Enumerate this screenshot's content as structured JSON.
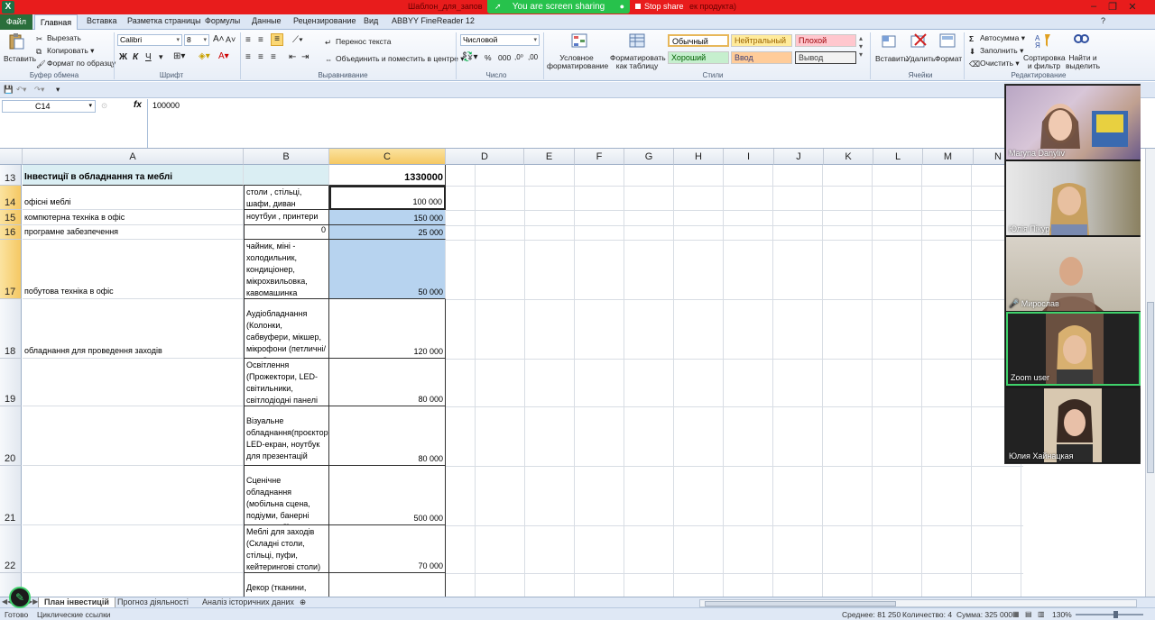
{
  "window": {
    "title_left": "Шаблон_для_запов",
    "title_right": "ек продукта)",
    "sharing_label": "You are screen sharing",
    "stop_share_label": "Stop share",
    "app_icon": "X"
  },
  "tabs": {
    "file": "Файл",
    "items": [
      "Главная",
      "Вставка",
      "Разметка страницы",
      "Формулы",
      "Данные",
      "Рецензирование",
      "Вид",
      "ABBYY FineReader 12"
    ]
  },
  "ribbon": {
    "clipboard": {
      "paste": "Вставить",
      "cut": "Вырезать",
      "copy": "Копировать",
      "format_painter": "Формат по образцу",
      "label": "Буфер обмена"
    },
    "font": {
      "name": "Calibri",
      "size": "8",
      "bold": "Ж",
      "italic": "К",
      "underline": "Ч",
      "label": "Шрифт"
    },
    "alignment": {
      "wrap": "Перенос текста",
      "merge": "Объединить и поместить в центре",
      "label": "Выравнивание"
    },
    "number": {
      "format": "Числовой",
      "percent": "%",
      "thousands": "000",
      "label": "Число"
    },
    "styles": {
      "conditional": "Условное форматирование",
      "as_table": "Форматировать как таблицу",
      "normal": "Обычный",
      "neutral": "Нейтральный",
      "bad": "Плохой",
      "good": "Хороший",
      "input": "Ввод",
      "output": "Вывод",
      "label": "Стили"
    },
    "cells": {
      "insert": "Вставить",
      "delete": "Удалить",
      "format": "Формат",
      "label": "Ячейки"
    },
    "editing": {
      "autosum": "Автосумма",
      "fill": "Заполнить",
      "clear": "Очистить",
      "sort": "Сортировка и фильтр",
      "find": "Найти и выделить",
      "label": "Редактирование"
    }
  },
  "formula_bar": {
    "name_box": "C14",
    "fx": "fx",
    "value": "100000"
  },
  "columns": [
    "A",
    "B",
    "C",
    "D",
    "E",
    "F",
    "G",
    "H",
    "I",
    "J",
    "K",
    "L",
    "M",
    "N"
  ],
  "rows": [
    {
      "num": "13",
      "a": "Інвестиції в обладнання та меблі",
      "b": "",
      "c": "1330000"
    },
    {
      "num": "14",
      "a": "офісні меблі",
      "b": "столи , стільці, шафи, диван",
      "c": "100 000"
    },
    {
      "num": "15",
      "a": "компютерна техніка в офіс",
      "b": "ноутбуи , принтери",
      "c": "150 000"
    },
    {
      "num": "16",
      "a": "програмне забезпечення",
      "b": "0",
      "c": "25 000"
    },
    {
      "num": "17",
      "a": "побутова техніка в офіс",
      "b": "чайник, міні - холодильник, кондиціонер, мікрохвильовка, кавомашинка",
      "c": "50 000"
    },
    {
      "num": "18",
      "a": "обладнання для проведення заходів",
      "b": "Аудіобладнання (Колонки, сабвуфери, мікшер, мікрофони (петличні/ручні)",
      "c": "120 000"
    },
    {
      "num": "19",
      "a": "",
      "b": "Освітлення (Прожектори, LED-світильники, світлодіодні панелі",
      "c": "80 000"
    },
    {
      "num": "20",
      "a": "",
      "b": "Візуальне обладнання(проєктор, LED-екран, ноутбук для презентацій",
      "c": "80 000"
    },
    {
      "num": "21",
      "a": "",
      "b": "Сценічне обладнання (мобільна сцена, подіуми, банерні конструкції)",
      "c": "500 000"
    },
    {
      "num": "22",
      "a": "",
      "b": "Меблі для заходів (Складні столи, стільці, пуфи, кейтерингові столи)",
      "c": "70 000"
    },
    {
      "num": "",
      "a": "",
      "b": "Декор (тканини, арки,",
      "c": ""
    }
  ],
  "participants": [
    {
      "name": "Maryna Danyliv"
    },
    {
      "name": "Юлія Пікур"
    },
    {
      "name": "Мирослав"
    },
    {
      "name": "Zoom user"
    },
    {
      "name": "Юлия Хайнацкая"
    }
  ],
  "sheets": [
    "План інвестицій",
    "Прогноз діяльності",
    "Аналіз історичних даних"
  ],
  "status": {
    "ready": "Готово",
    "circular": "Циклические ссылки",
    "average": "Среднее: 81 250",
    "count": "Количество: 4",
    "sum": "Сумма: 325 000",
    "zoom": "130%"
  },
  "colors": {
    "accent_green": "#27c24c",
    "title_red": "#e81c1c",
    "selected_fill": "#b7d3ef",
    "header_fill": "#daeef3"
  }
}
